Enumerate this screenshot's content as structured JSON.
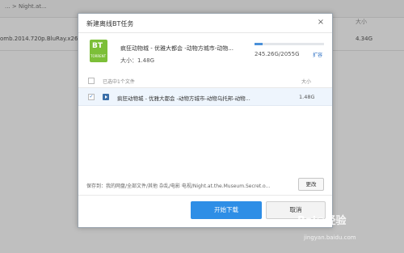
{
  "background": {
    "breadcrumb": "... > Night.at...",
    "col_size": "大小",
    "file_name": "omb.2014.720p.BluRay.x264-D",
    "file_size": "4.34G"
  },
  "dialog": {
    "title": "新建离线BT任务",
    "close_symbol": "×",
    "torrent": {
      "icon_text": "BT",
      "icon_caption": "TORRENT",
      "name": "疯狂动物城 - 优雅大都会 -动物方城市-动物...",
      "size_text": "大小：1.48G"
    },
    "quota": {
      "text": "245.26G/2055G",
      "used_fraction": 0.12,
      "expand_label": "扩容",
      "bar_color": "#4a90d9"
    },
    "list": {
      "header_selected": "已选中1个文件",
      "header_size": "大小",
      "files": [
        {
          "name": "疯狂动物城 - 优雅大都会 -动物方城市-动物乌托邦-动物...",
          "size": "1.48G",
          "checked": true,
          "check_mark": "✓"
        }
      ]
    },
    "save_path": "保存到：我的网盘/全部文件/其他 杂乱/电影 电视/Night.at.the.Museum.Secret.o...",
    "change_button": "更改",
    "start_button": "开始下载",
    "cancel_button": "取消",
    "accent_color": "#2e8ee6"
  },
  "watermark": {
    "text": "Bai◎经验",
    "sub": "jingyan.baidu.com"
  }
}
